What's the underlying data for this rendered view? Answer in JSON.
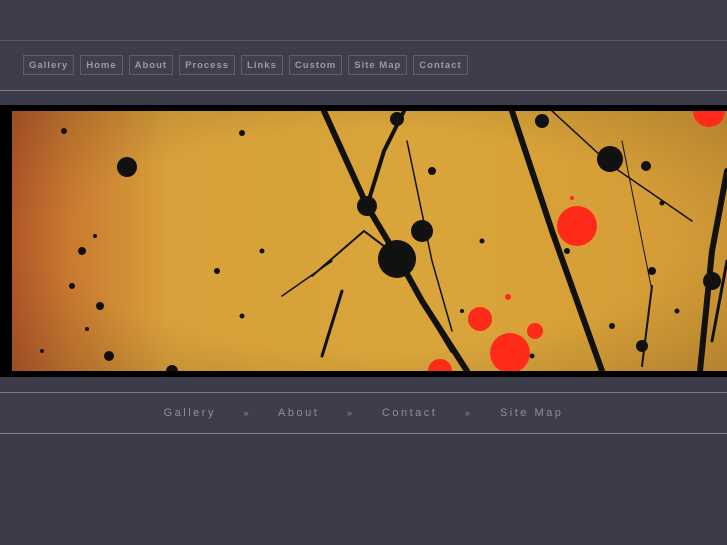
{
  "nav": {
    "items": [
      {
        "label": "Gallery"
      },
      {
        "label": "Home"
      },
      {
        "label": "About"
      },
      {
        "label": "Process"
      },
      {
        "label": "Links"
      },
      {
        "label": "Custom"
      },
      {
        "label": "Site Map"
      },
      {
        "label": "Contact"
      }
    ]
  },
  "hero": {
    "image": "abstract-paint-splatter"
  },
  "footer_nav": {
    "items": [
      "Gallery",
      "About",
      "Contact",
      "Site Map"
    ],
    "separator": "»"
  },
  "colors": {
    "background": "#3b3b4a",
    "nav_text": "#9a9aaa",
    "canvas_ochre": "#d9a236",
    "splatter_red": "#ff2a1a"
  }
}
